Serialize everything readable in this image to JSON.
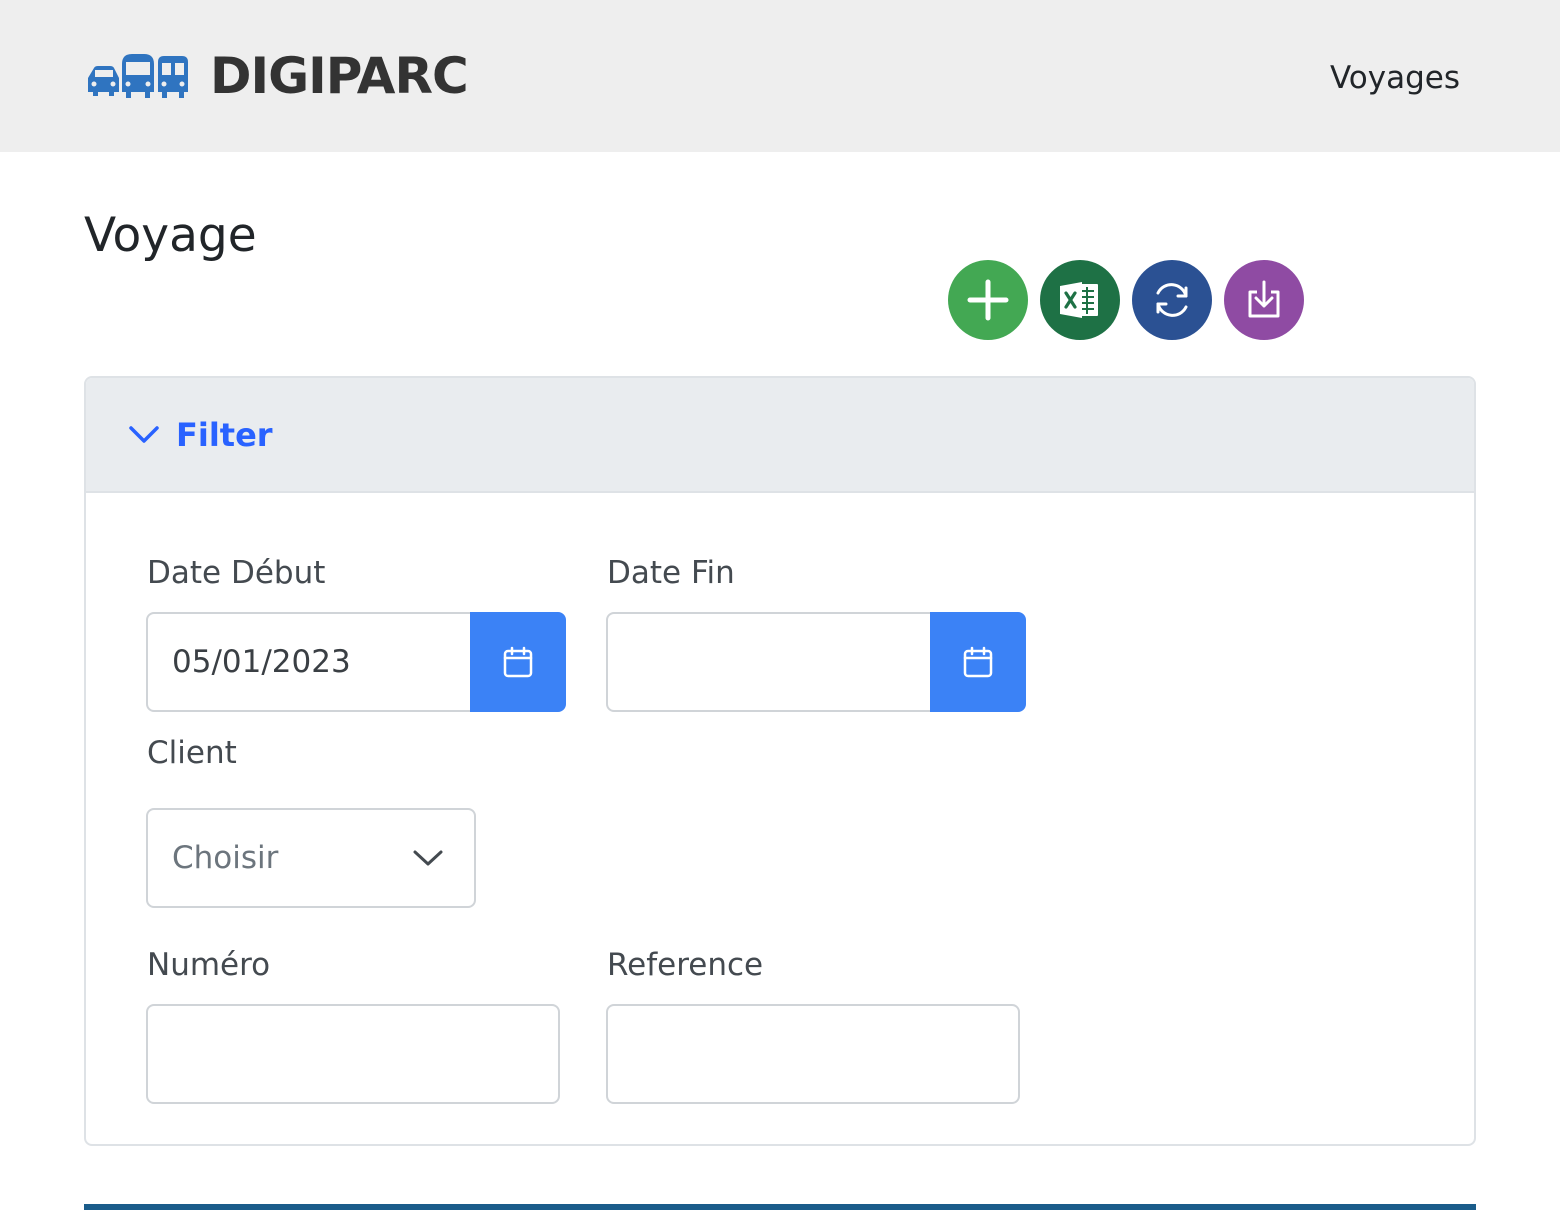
{
  "navbar": {
    "brand_name": "DIGIPARC",
    "logo_icon": "vehicles-logo-icon",
    "nav_link": "Voyages"
  },
  "page": {
    "title": "Voyage"
  },
  "actions": [
    {
      "name": "add-button",
      "icon": "plus-icon",
      "color": "#43a853"
    },
    {
      "name": "excel-export-button",
      "icon": "excel-icon",
      "color": "#1e7145"
    },
    {
      "name": "refresh-button",
      "icon": "refresh-icon",
      "color": "#2b5193"
    },
    {
      "name": "import-button",
      "icon": "download-tray-icon",
      "color": "#8f4ba3"
    }
  ],
  "filter": {
    "title": "Filter",
    "date_debut": {
      "label": "Date Début",
      "value": "05/01/2023"
    },
    "date_fin": {
      "label": "Date Fin",
      "value": ""
    },
    "client": {
      "label": "Client",
      "selected": "Choisir"
    },
    "numero": {
      "label": "Numéro",
      "value": ""
    },
    "reference": {
      "label": "Reference",
      "value": ""
    }
  },
  "colors": {
    "accent": "#3b82f6",
    "filter_title": "#2962ff",
    "navbar_bg": "#eeeeee",
    "bottom_bar": "#1a5c8a"
  }
}
